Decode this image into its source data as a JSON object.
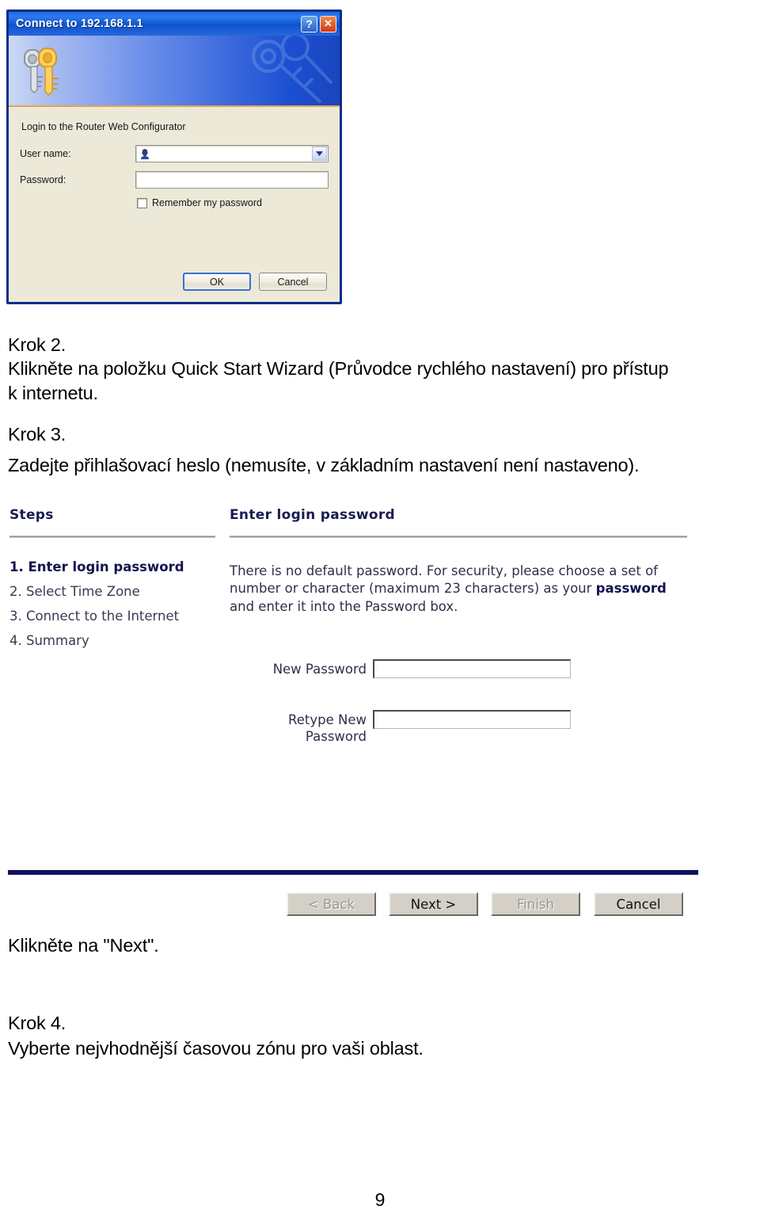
{
  "dialog": {
    "title": "Connect to 192.168.1.1",
    "help_button": "?",
    "close_button": "✕",
    "instruction": "Login to the Router Web Configurator",
    "username_label": "User name:",
    "username_value": "",
    "password_label": "Password:",
    "password_value": "",
    "remember_label": "Remember my password",
    "ok_label": "OK",
    "cancel_label": "Cancel"
  },
  "doc": {
    "step2_heading": "Krok 2.",
    "step2_line1": "Klikněte na položku Quick Start Wizard (Průvodce rychlého nastavení) pro přístup",
    "step2_line2": "k internetu.",
    "step3_heading": "Krok 3.",
    "step3_text": "Zadejte přihlašovací heslo (nemusíte, v základním nastavení není nastaveno).",
    "click_next": "Klikněte na \"Next\".",
    "step4_heading": "Krok 4.",
    "step4_text": "Vyberte nejvhodnější časovou zónu pro vaši oblast.",
    "page_number": "9"
  },
  "wizard": {
    "steps_heading": "Steps",
    "panel_heading": "Enter login password",
    "steps": [
      "1. Enter login password",
      "2. Select Time Zone",
      "3. Connect to the Internet",
      "4. Summary"
    ],
    "description_part1": "There is no default password. For security, please choose a set of number or character (maximum 23 characters) as your ",
    "description_bold": "password",
    "description_part2": " and enter it into the Password box.",
    "new_password_label": "New Password",
    "new_password_value": "",
    "retype_label_line1": "Retype New",
    "retype_label_line2": "Password",
    "retype_password_value": "",
    "buttons": {
      "back": "< Back",
      "next": "Next >",
      "finish": "Finish",
      "cancel": "Cancel"
    }
  },
  "colors": {
    "xp_title_blue": "#0f53cf",
    "wizard_navy": "#101060",
    "wizard_rule_gray": "#8f8f99",
    "banner_orange": "#e8a34a"
  }
}
